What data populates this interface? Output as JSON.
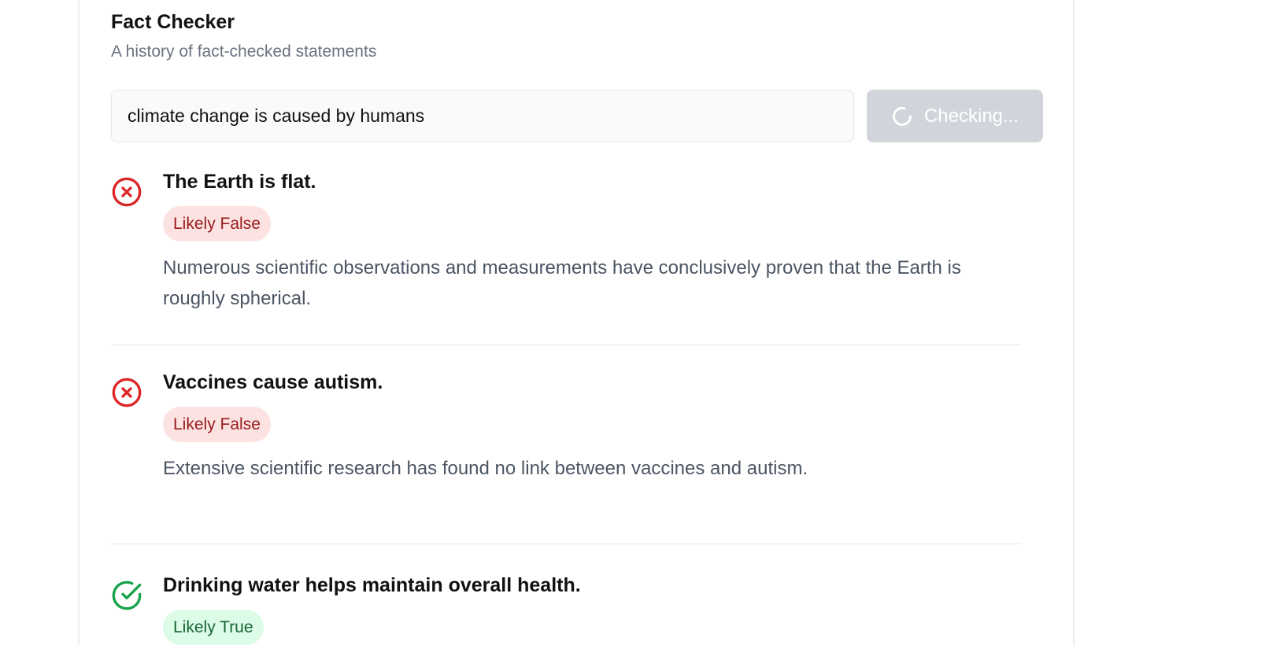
{
  "app": {
    "title": "Fact Checker",
    "subtitle": "A history of fact-checked statements"
  },
  "search": {
    "value": "climate change is caused by humans",
    "button_label": "Checking...",
    "button_state": "loading"
  },
  "colors": {
    "false": "#dc2626",
    "true": "#16a34a",
    "button_disabled": "#d1d5db"
  },
  "entries": [
    {
      "statement": "The Earth is flat.",
      "verdict": "Likely False",
      "icon": "x-circle-icon",
      "explanation": "Numerous scientific observations and measurements have conclusively proven that the Earth is roughly spherical."
    },
    {
      "statement": "Vaccines cause autism.",
      "verdict": "Likely False",
      "icon": "x-circle-icon",
      "explanation": "Extensive scientific research has found no link between vaccines and autism."
    },
    {
      "statement": "Drinking water helps maintain overall health.",
      "verdict": "Likely True",
      "icon": "check-circle-icon"
    }
  ]
}
